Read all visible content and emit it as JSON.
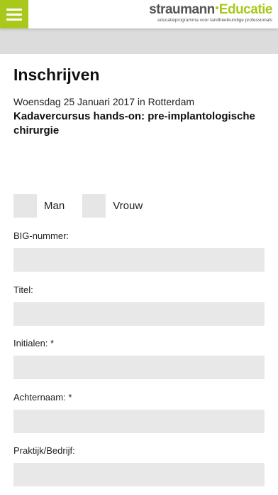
{
  "header": {
    "logo_brand": "straumann",
    "logo_edu": "Educatie",
    "logo_tagline": "educatieprogramma voor tandheelkundige professionals",
    "accent_color": "#a8c81c",
    "menu_icon": "hamburger-icon"
  },
  "page": {
    "title": "Inschrijven",
    "event_date": "Woensdag 25 Januari 2017 in Rotterdam",
    "event_name": "Kadavercursus hands-on: pre-implantologische chirurgie"
  },
  "form": {
    "gender_options": [
      "Man",
      "Vrouw"
    ],
    "fields": [
      {
        "label": "BIG-nummer:",
        "value": ""
      },
      {
        "label": "Titel:",
        "value": ""
      },
      {
        "label": "Initialen: *",
        "value": ""
      },
      {
        "label": "Achternaam: *",
        "value": ""
      },
      {
        "label": "Praktijk/Bedrijf:",
        "value": ""
      }
    ]
  }
}
